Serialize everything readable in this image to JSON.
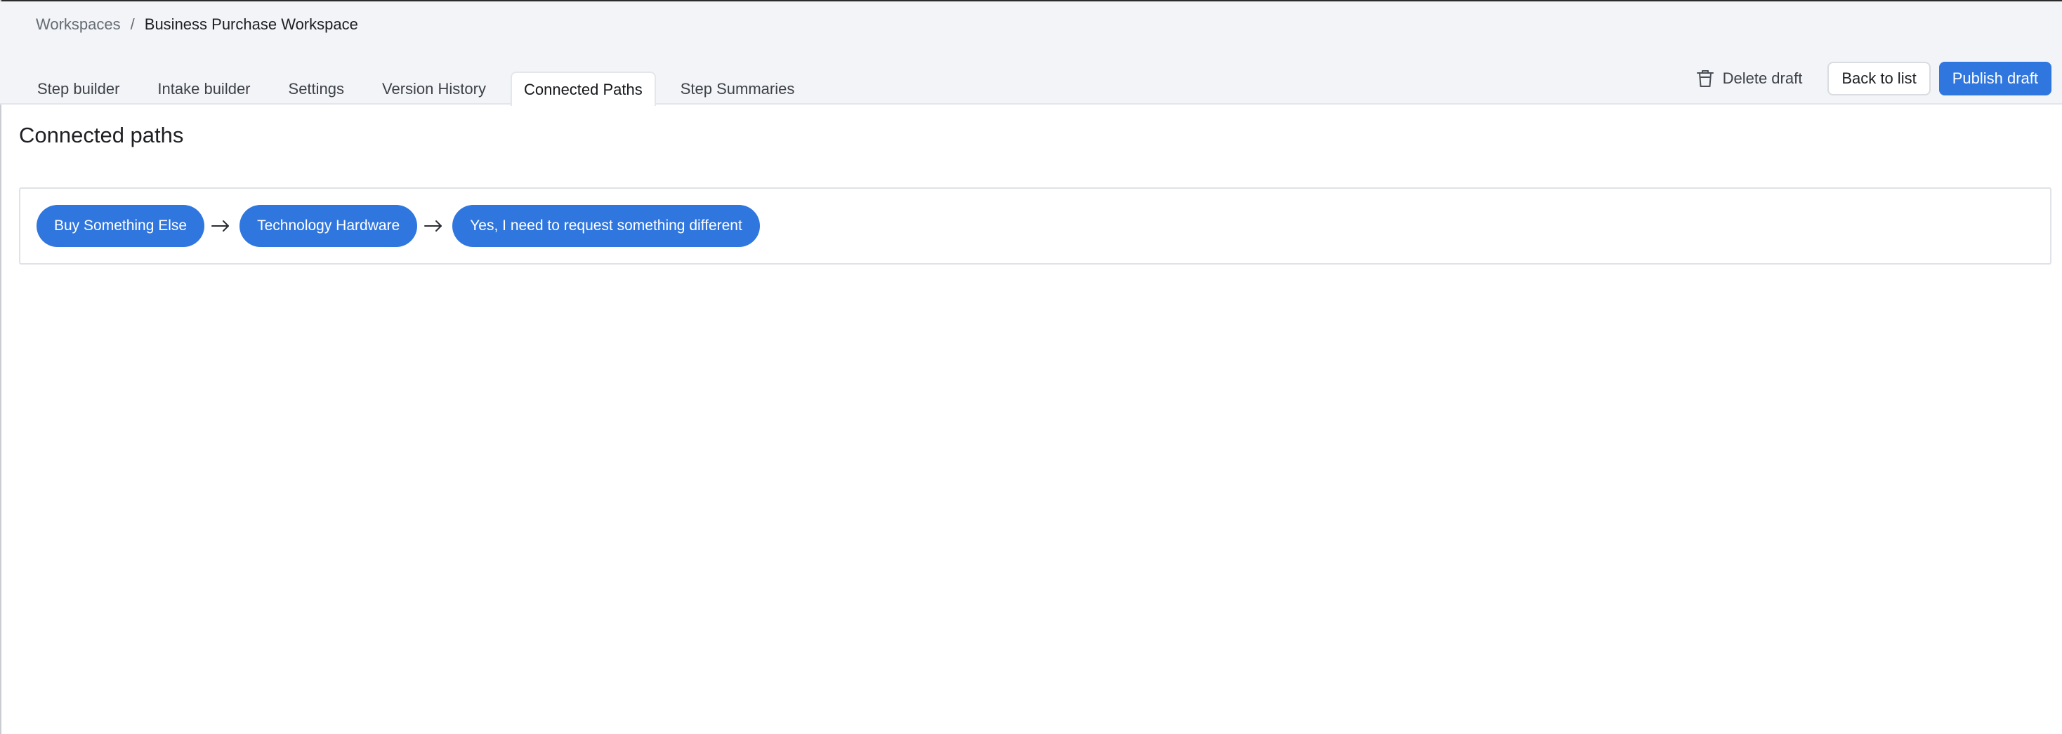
{
  "breadcrumb": {
    "parent": "Workspaces",
    "separator": "/",
    "current": "Business Purchase Workspace"
  },
  "tabs": [
    {
      "label": "Step builder",
      "active": false
    },
    {
      "label": "Intake builder",
      "active": false
    },
    {
      "label": "Settings",
      "active": false
    },
    {
      "label": "Version History",
      "active": false
    },
    {
      "label": "Connected Paths",
      "active": true
    },
    {
      "label": "Step Summaries",
      "active": false
    }
  ],
  "actions": {
    "delete_label": "Delete draft",
    "delete_icon": "trash-icon",
    "back_label": "Back to list",
    "publish_label": "Publish draft"
  },
  "page": {
    "title": "Connected paths"
  },
  "path": {
    "steps": [
      "Buy Something Else",
      "Technology Hardware",
      "Yes, I need to request something different"
    ],
    "separator_icon": "arrow-right-icon"
  },
  "colors": {
    "accent": "#2f76df",
    "header_bg": "#f2f4f7",
    "border": "#dfe2e6"
  }
}
